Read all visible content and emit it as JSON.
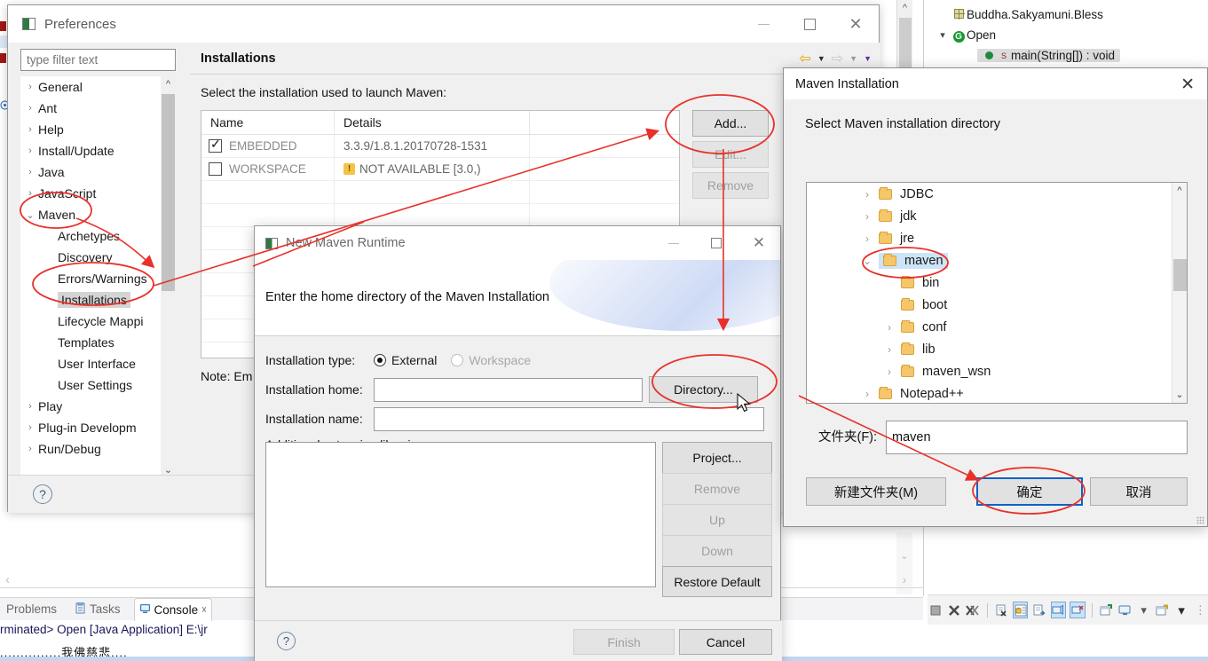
{
  "outline": {
    "rows": [
      {
        "label": "Buddha.Sakyamuni.Bless",
        "icon": "package-icon"
      },
      {
        "label": "Open",
        "icon": "class-icon"
      },
      {
        "label": "main(String[]) : void",
        "icon": "method-icon"
      }
    ]
  },
  "console": {
    "tabs": [
      {
        "label": "Problems",
        "active": false
      },
      {
        "label": "Tasks",
        "active": false
      },
      {
        "label": "Console",
        "active": true,
        "close": "⌧"
      }
    ],
    "line1": "rminated> Open [Java Application] E:\\jr",
    "line2": "...............我佛慈悲...."
  },
  "preferences": {
    "title": "Preferences",
    "filter_placeholder": "type filter text",
    "tree": [
      {
        "label": "General",
        "expandable": true,
        "child": false,
        "expanded": false,
        "selected": false
      },
      {
        "label": "Ant",
        "expandable": true,
        "child": false,
        "expanded": false,
        "selected": false
      },
      {
        "label": "Help",
        "expandable": true,
        "child": false,
        "expanded": false,
        "selected": false
      },
      {
        "label": "Install/Update",
        "expandable": true,
        "child": false,
        "expanded": false,
        "selected": false
      },
      {
        "label": "Java",
        "expandable": true,
        "child": false,
        "expanded": false,
        "selected": false
      },
      {
        "label": "JavaScript",
        "expandable": true,
        "child": false,
        "expanded": false,
        "selected": false
      },
      {
        "label": "Maven",
        "expandable": true,
        "child": false,
        "expanded": true,
        "selected": false
      },
      {
        "label": "Archetypes",
        "expandable": false,
        "child": true,
        "expanded": false,
        "selected": false
      },
      {
        "label": "Discovery",
        "expandable": false,
        "child": true,
        "expanded": false,
        "selected": false
      },
      {
        "label": "Errors/Warnings",
        "expandable": false,
        "child": true,
        "expanded": false,
        "selected": false
      },
      {
        "label": "Installations",
        "expandable": false,
        "child": true,
        "expanded": false,
        "selected": true
      },
      {
        "label": "Lifecycle Mappi",
        "expandable": false,
        "child": true,
        "expanded": false,
        "selected": false
      },
      {
        "label": "Templates",
        "expandable": false,
        "child": true,
        "expanded": false,
        "selected": false
      },
      {
        "label": "User Interface",
        "expandable": false,
        "child": true,
        "expanded": false,
        "selected": false
      },
      {
        "label": "User Settings",
        "expandable": false,
        "child": true,
        "expanded": false,
        "selected": false
      },
      {
        "label": "Play",
        "expandable": true,
        "child": false,
        "expanded": false,
        "selected": false
      },
      {
        "label": "Plug-in Developm",
        "expandable": true,
        "child": false,
        "expanded": false,
        "selected": false
      },
      {
        "label": "Run/Debug",
        "expandable": true,
        "child": false,
        "expanded": false,
        "selected": false
      }
    ],
    "page": {
      "heading": "Installations",
      "lead": "Select the installation used to launch Maven:",
      "columns": [
        "Name",
        "Details"
      ],
      "rows": [
        {
          "checked": true,
          "name": "EMBEDDED",
          "details": "3.3.9/1.8.1.20170728-1531",
          "warn": false
        },
        {
          "checked": false,
          "name": "WORKSPACE",
          "details": "NOT AVAILABLE [3.0,)",
          "warn": true
        }
      ],
      "buttons": [
        {
          "label": "Add...",
          "enabled": true
        },
        {
          "label": "Edit...",
          "enabled": false
        },
        {
          "label": "Remove",
          "enabled": false
        }
      ],
      "note": "Note: Em"
    }
  },
  "new_maven_runtime": {
    "title": "New Maven Runtime",
    "banner_message": "Enter the home directory of the Maven Installation",
    "installation_type_label": "Installation type:",
    "type_options": [
      {
        "label": "External",
        "selected": true
      },
      {
        "label": "Workspace",
        "selected": false
      }
    ],
    "installation_home_label": "Installation home:",
    "installation_home_value": "",
    "directory_button": "Directory...",
    "installation_name_label": "Installation name:",
    "installation_name_value": "",
    "additional_libraries_label": "Additional extension libraries:",
    "library_buttons": [
      {
        "label": "Project...",
        "enabled": true
      },
      {
        "label": "Remove",
        "enabled": false
      },
      {
        "label": "Up",
        "enabled": false
      },
      {
        "label": "Down",
        "enabled": false
      },
      {
        "label": "Restore Default",
        "enabled": true
      }
    ],
    "finish_button": "Finish",
    "cancel_button": "Cancel"
  },
  "maven_installation": {
    "title": "Maven Installation",
    "prompt": "Select Maven installation directory",
    "tree": [
      {
        "label": "JDBC",
        "indent": 0,
        "expandable": true,
        "expanded": false,
        "selected": false
      },
      {
        "label": "jdk",
        "indent": 0,
        "expandable": true,
        "expanded": false,
        "selected": false
      },
      {
        "label": "jre",
        "indent": 0,
        "expandable": true,
        "expanded": false,
        "selected": false
      },
      {
        "label": "maven",
        "indent": 0,
        "expandable": true,
        "expanded": true,
        "selected": true
      },
      {
        "label": "bin",
        "indent": 1,
        "expandable": false,
        "expanded": false,
        "selected": false
      },
      {
        "label": "boot",
        "indent": 1,
        "expandable": false,
        "expanded": false,
        "selected": false
      },
      {
        "label": "conf",
        "indent": 1,
        "expandable": true,
        "expanded": false,
        "selected": false
      },
      {
        "label": "lib",
        "indent": 1,
        "expandable": true,
        "expanded": false,
        "selected": false
      },
      {
        "label": "maven_wsn",
        "indent": 1,
        "expandable": true,
        "expanded": false,
        "selected": false
      },
      {
        "label": "Notepad++",
        "indent": 0,
        "expandable": true,
        "expanded": false,
        "selected": false
      }
    ],
    "folder_label": "文件夹(F):",
    "folder_value": "maven",
    "new_folder_button": "新建文件夹(M)",
    "ok_button": "确定",
    "cancel_button": "取消"
  },
  "colors": {
    "annotation": "#e8312a",
    "primary_border": "#0a64c8",
    "selection": "#cce4f7"
  }
}
